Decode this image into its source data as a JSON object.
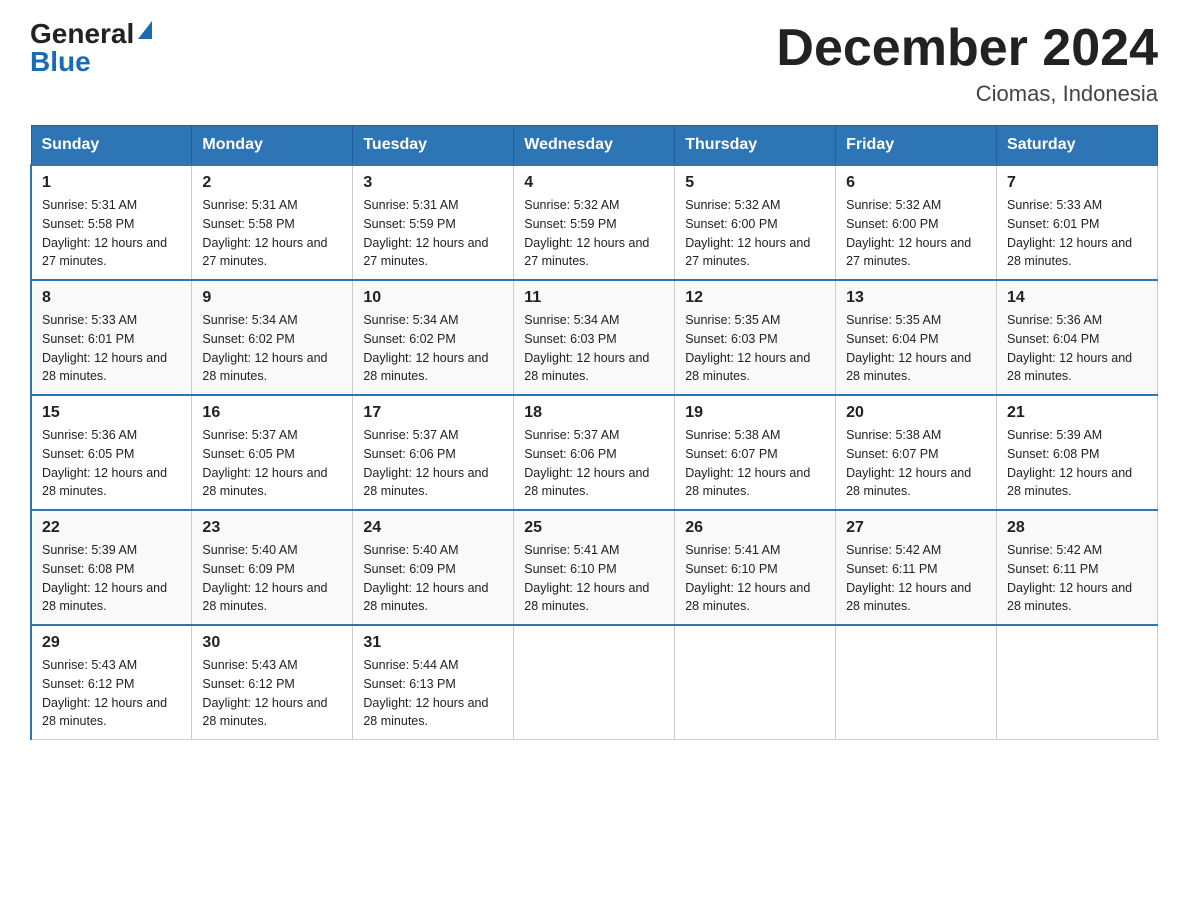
{
  "logo": {
    "general": "General",
    "triangle_char": "",
    "blue": "Blue"
  },
  "header": {
    "month_title": "December 2024",
    "subtitle": "Ciomas, Indonesia"
  },
  "days_of_week": [
    "Sunday",
    "Monday",
    "Tuesday",
    "Wednesday",
    "Thursday",
    "Friday",
    "Saturday"
  ],
  "weeks": [
    [
      {
        "day": "1",
        "sunrise": "5:31 AM",
        "sunset": "5:58 PM",
        "daylight": "12 hours and 27 minutes."
      },
      {
        "day": "2",
        "sunrise": "5:31 AM",
        "sunset": "5:58 PM",
        "daylight": "12 hours and 27 minutes."
      },
      {
        "day": "3",
        "sunrise": "5:31 AM",
        "sunset": "5:59 PM",
        "daylight": "12 hours and 27 minutes."
      },
      {
        "day": "4",
        "sunrise": "5:32 AM",
        "sunset": "5:59 PM",
        "daylight": "12 hours and 27 minutes."
      },
      {
        "day": "5",
        "sunrise": "5:32 AM",
        "sunset": "6:00 PM",
        "daylight": "12 hours and 27 minutes."
      },
      {
        "day": "6",
        "sunrise": "5:32 AM",
        "sunset": "6:00 PM",
        "daylight": "12 hours and 27 minutes."
      },
      {
        "day": "7",
        "sunrise": "5:33 AM",
        "sunset": "6:01 PM",
        "daylight": "12 hours and 28 minutes."
      }
    ],
    [
      {
        "day": "8",
        "sunrise": "5:33 AM",
        "sunset": "6:01 PM",
        "daylight": "12 hours and 28 minutes."
      },
      {
        "day": "9",
        "sunrise": "5:34 AM",
        "sunset": "6:02 PM",
        "daylight": "12 hours and 28 minutes."
      },
      {
        "day": "10",
        "sunrise": "5:34 AM",
        "sunset": "6:02 PM",
        "daylight": "12 hours and 28 minutes."
      },
      {
        "day": "11",
        "sunrise": "5:34 AM",
        "sunset": "6:03 PM",
        "daylight": "12 hours and 28 minutes."
      },
      {
        "day": "12",
        "sunrise": "5:35 AM",
        "sunset": "6:03 PM",
        "daylight": "12 hours and 28 minutes."
      },
      {
        "day": "13",
        "sunrise": "5:35 AM",
        "sunset": "6:04 PM",
        "daylight": "12 hours and 28 minutes."
      },
      {
        "day": "14",
        "sunrise": "5:36 AM",
        "sunset": "6:04 PM",
        "daylight": "12 hours and 28 minutes."
      }
    ],
    [
      {
        "day": "15",
        "sunrise": "5:36 AM",
        "sunset": "6:05 PM",
        "daylight": "12 hours and 28 minutes."
      },
      {
        "day": "16",
        "sunrise": "5:37 AM",
        "sunset": "6:05 PM",
        "daylight": "12 hours and 28 minutes."
      },
      {
        "day": "17",
        "sunrise": "5:37 AM",
        "sunset": "6:06 PM",
        "daylight": "12 hours and 28 minutes."
      },
      {
        "day": "18",
        "sunrise": "5:37 AM",
        "sunset": "6:06 PM",
        "daylight": "12 hours and 28 minutes."
      },
      {
        "day": "19",
        "sunrise": "5:38 AM",
        "sunset": "6:07 PM",
        "daylight": "12 hours and 28 minutes."
      },
      {
        "day": "20",
        "sunrise": "5:38 AM",
        "sunset": "6:07 PM",
        "daylight": "12 hours and 28 minutes."
      },
      {
        "day": "21",
        "sunrise": "5:39 AM",
        "sunset": "6:08 PM",
        "daylight": "12 hours and 28 minutes."
      }
    ],
    [
      {
        "day": "22",
        "sunrise": "5:39 AM",
        "sunset": "6:08 PM",
        "daylight": "12 hours and 28 minutes."
      },
      {
        "day": "23",
        "sunrise": "5:40 AM",
        "sunset": "6:09 PM",
        "daylight": "12 hours and 28 minutes."
      },
      {
        "day": "24",
        "sunrise": "5:40 AM",
        "sunset": "6:09 PM",
        "daylight": "12 hours and 28 minutes."
      },
      {
        "day": "25",
        "sunrise": "5:41 AM",
        "sunset": "6:10 PM",
        "daylight": "12 hours and 28 minutes."
      },
      {
        "day": "26",
        "sunrise": "5:41 AM",
        "sunset": "6:10 PM",
        "daylight": "12 hours and 28 minutes."
      },
      {
        "day": "27",
        "sunrise": "5:42 AM",
        "sunset": "6:11 PM",
        "daylight": "12 hours and 28 minutes."
      },
      {
        "day": "28",
        "sunrise": "5:42 AM",
        "sunset": "6:11 PM",
        "daylight": "12 hours and 28 minutes."
      }
    ],
    [
      {
        "day": "29",
        "sunrise": "5:43 AM",
        "sunset": "6:12 PM",
        "daylight": "12 hours and 28 minutes."
      },
      {
        "day": "30",
        "sunrise": "5:43 AM",
        "sunset": "6:12 PM",
        "daylight": "12 hours and 28 minutes."
      },
      {
        "day": "31",
        "sunrise": "5:44 AM",
        "sunset": "6:13 PM",
        "daylight": "12 hours and 28 minutes."
      },
      null,
      null,
      null,
      null
    ]
  ],
  "labels": {
    "sunrise": "Sunrise:",
    "sunset": "Sunset:",
    "daylight": "Daylight:"
  }
}
